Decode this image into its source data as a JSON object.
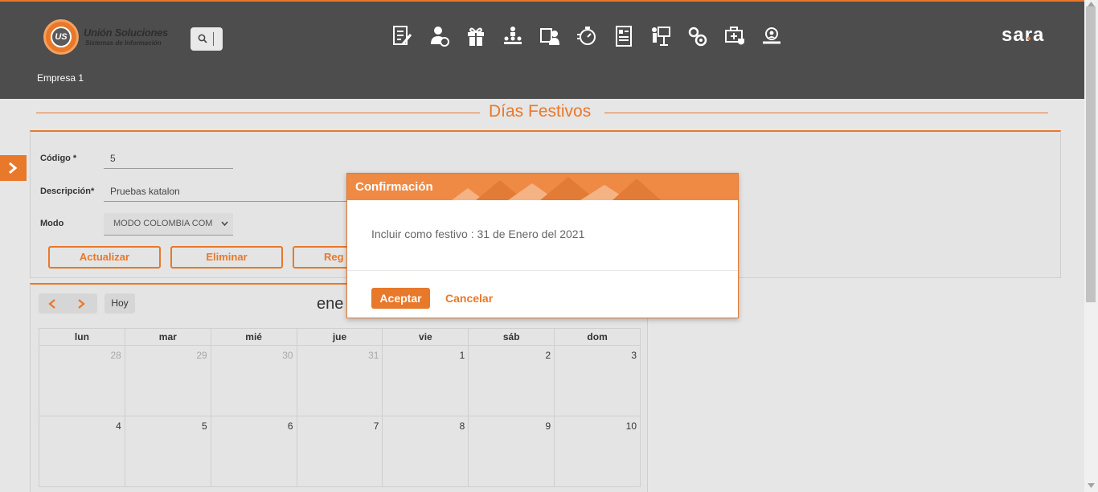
{
  "header": {
    "logo_mark": "US",
    "logo_name": "Unión Soluciones",
    "logo_subtitle": "Sistemas de Información",
    "brand": "sara",
    "company": "Empresa 1",
    "module_icons": [
      "document-edit-icon",
      "user-money-icon",
      "gift-icon",
      "org-chart-icon",
      "employee-tasks-icon",
      "stopwatch-icon",
      "report-icon",
      "presentation-icon",
      "settings-gears-icon",
      "medical-briefcase-icon",
      "user-search-icon"
    ]
  },
  "page": {
    "title": "Días Festivos"
  },
  "form": {
    "codigo_label": "Código *",
    "codigo_value": "5",
    "descripcion_label": "Descripción*",
    "descripcion_value": "Pruebas katalon",
    "modo_label": "Modo",
    "modo_value": "MODO COLOMBIA COM",
    "buttons": {
      "update": "Actualizar",
      "delete": "Eliminar",
      "third": "Reg"
    }
  },
  "calendar": {
    "today_label": "Hoy",
    "title": "ene",
    "weekdays": [
      "lun",
      "mar",
      "mié",
      "jue",
      "vie",
      "sáb",
      "dom"
    ],
    "weeks": [
      [
        {
          "d": "28",
          "muted": true
        },
        {
          "d": "29",
          "muted": true
        },
        {
          "d": "30",
          "muted": true
        },
        {
          "d": "31",
          "muted": true
        },
        {
          "d": "1",
          "muted": false
        },
        {
          "d": "2",
          "muted": false
        },
        {
          "d": "3",
          "muted": false
        }
      ],
      [
        {
          "d": "4",
          "muted": false
        },
        {
          "d": "5",
          "muted": false
        },
        {
          "d": "6",
          "muted": false
        },
        {
          "d": "7",
          "muted": false
        },
        {
          "d": "8",
          "muted": false
        },
        {
          "d": "9",
          "muted": false
        },
        {
          "d": "10",
          "muted": false
        }
      ]
    ]
  },
  "modal": {
    "title": "Confirmación",
    "message": "Incluir como festivo : 31 de Enero del 2021",
    "accept_label": "Aceptar",
    "cancel_label": "Cancelar"
  },
  "colors": {
    "accent": "#e8782a",
    "header_bg": "#4d4d4d",
    "page_bg": "#e6e6e6"
  }
}
